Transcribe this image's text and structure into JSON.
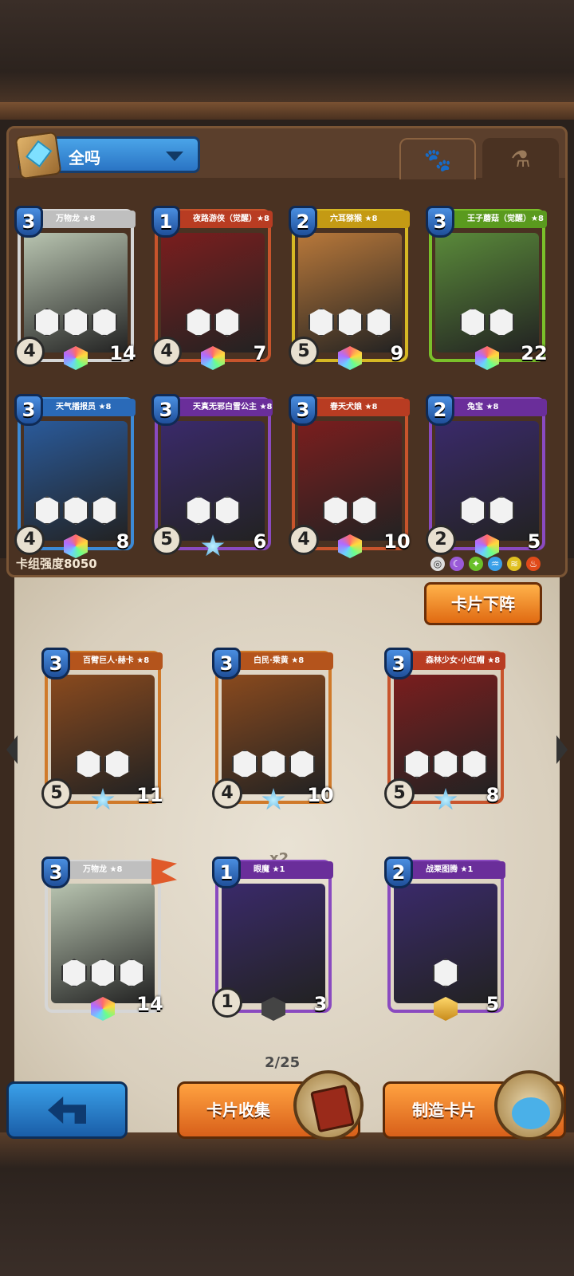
{
  "filter": {
    "label": "全吗"
  },
  "tabs": {
    "paw": "🐾",
    "potion": "⚗"
  },
  "deck": {
    "strength_label": "卡组强度8050",
    "cards": [
      {
        "name": "万物龙 ★8",
        "cost": "3",
        "atk": "4",
        "hp": "14",
        "color": "white",
        "skills": [
          "1",
          "",
          "2"
        ]
      },
      {
        "name": "夜路游侠（觉醒）★8",
        "cost": "1",
        "atk": "4",
        "hp": "7",
        "color": "red",
        "skills": [
          "",
          "1"
        ]
      },
      {
        "name": "六耳猕猴 ★8",
        "cost": "2",
        "atk": "5",
        "hp": "9",
        "color": "yellow",
        "skills": [
          "",
          "",
          "1"
        ]
      },
      {
        "name": "王子蘑菇（觉醒）★8",
        "cost": "3",
        "atk": "",
        "hp": "22",
        "color": "green",
        "skills": [
          "2",
          ""
        ]
      },
      {
        "name": "天气播报员 ★8",
        "cost": "3",
        "atk": "4",
        "hp": "8",
        "color": "blue",
        "skills": [
          "",
          "1",
          "1"
        ]
      },
      {
        "name": "天真无邪白雪公主 ★8",
        "cost": "3",
        "atk": "5",
        "hp": "6",
        "color": "purple",
        "skills": [
          "1",
          ""
        ]
      },
      {
        "name": "春天犬娘 ★8",
        "cost": "3",
        "atk": "4",
        "hp": "10",
        "color": "red",
        "skills": [
          "1",
          ""
        ]
      },
      {
        "name": "兔宝 ★8",
        "cost": "2",
        "atk": "2",
        "hp": "5",
        "color": "purple",
        "skills": [
          "1",
          ""
        ]
      }
    ]
  },
  "collection": {
    "lower_button": "卡片下阵",
    "copies": "x2",
    "page": "2/25",
    "cards": [
      {
        "name": "百臂巨人·赫卡 ★8",
        "cost": "3",
        "atk": "5",
        "hp": "11",
        "color": "orange",
        "skills": [
          "",
          ""
        ]
      },
      {
        "name": "白民·乘黄 ★8",
        "cost": "3",
        "atk": "4",
        "hp": "10",
        "color": "orange",
        "skills": [
          "",
          "2",
          ""
        ]
      },
      {
        "name": "森林少女·小红帽 ★8",
        "cost": "3",
        "atk": "5",
        "hp": "8",
        "color": "red",
        "skills": [
          "1",
          "2",
          "1"
        ]
      },
      {
        "name": "万物龙 ★8",
        "cost": "3",
        "atk": "",
        "hp": "14",
        "color": "white",
        "skills": [
          "1",
          "",
          "2"
        ]
      },
      {
        "name": "眼魔 ★1",
        "cost": "1",
        "atk": "1",
        "hp": "3",
        "color": "purple",
        "skills": []
      },
      {
        "name": "战栗图腾 ★1",
        "cost": "2",
        "atk": "",
        "hp": "5",
        "color": "purple",
        "skills": [
          "2"
        ]
      }
    ]
  },
  "bottom": {
    "collect": "卡片收集",
    "craft": "制造卡片"
  }
}
